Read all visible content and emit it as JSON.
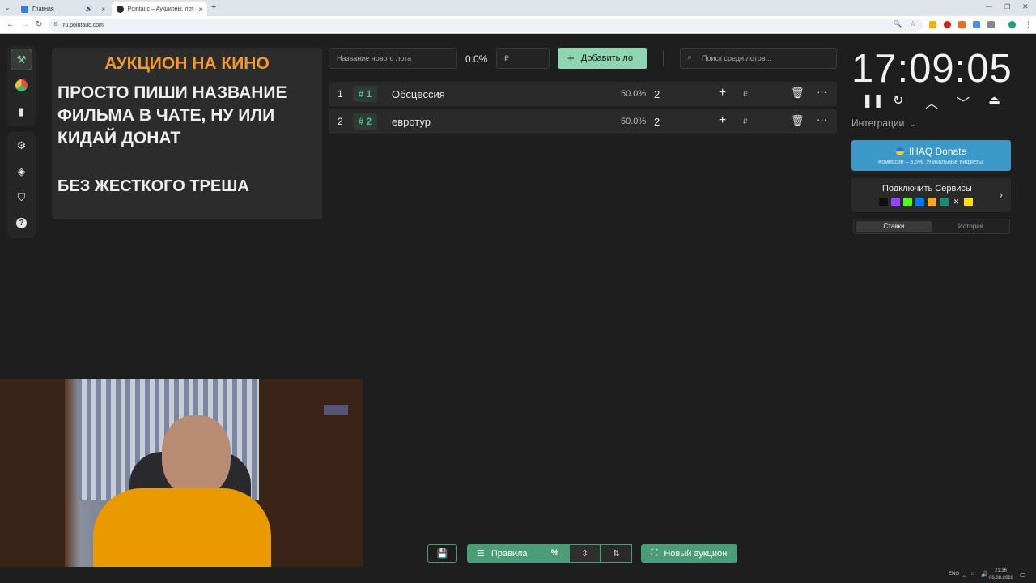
{
  "browser": {
    "tabs": [
      {
        "label": "Главная",
        "color": "#3a7bd5"
      },
      {
        "label": "Pointauc – Аукционы, лотере…",
        "color": "#2a2a2a"
      }
    ],
    "url": "ru.pointauc.com"
  },
  "sidebar": {
    "icons": [
      "gavel-icon",
      "pie-chart-icon",
      "bar-chart-icon",
      "gear-icon",
      "layers-icon",
      "shield-icon",
      "help-icon"
    ]
  },
  "message_card": {
    "title": "АУКЦИОН НА КИНО",
    "body": "ПРОСТО ПИШИ НАЗВАНИЕ ФИЛЬМА В ЧАТЕ, НУ ИЛИ КИДАЙ ДОНАТ",
    "note": "БЕЗ ЖЕСТКОГО ТРЕША"
  },
  "toolbar": {
    "new_lot_placeholder": "Название нового лота",
    "percent": "0.0%",
    "amount_placeholder": "₽",
    "add_lot_label": "Добавить ло",
    "search_placeholder": "Поиск среди лотов..."
  },
  "lots": [
    {
      "num": "1",
      "badge": "# 1",
      "name": "Обсцессия",
      "pct": "50.0%",
      "amount": "2",
      "rub": "₽"
    },
    {
      "num": "2",
      "badge": "# 2",
      "name": "евротур",
      "pct": "50.0%",
      "amount": "2",
      "rub": "₽"
    }
  ],
  "timer": {
    "time": "17:09:05",
    "integrations_label": "Интеграции"
  },
  "donate": {
    "title": "IHAQ Donate",
    "subtitle": "Комиссия – 3,5%. Уникальные виджеты!"
  },
  "services": {
    "title": "Подключить Сервисы"
  },
  "history_tabs": {
    "bets": "Ставки",
    "history": "История"
  },
  "bottom_bar": {
    "rules_label": "Правила",
    "new_auction_label": "Новый аукцион"
  },
  "taskbar": {
    "lang": "ENG",
    "time": "21:36",
    "date": "06.08.2026"
  },
  "colors": {
    "accent_green": "#4a9d76",
    "title_orange": "#f29a2b",
    "donate_blue": "#3c98c8"
  }
}
